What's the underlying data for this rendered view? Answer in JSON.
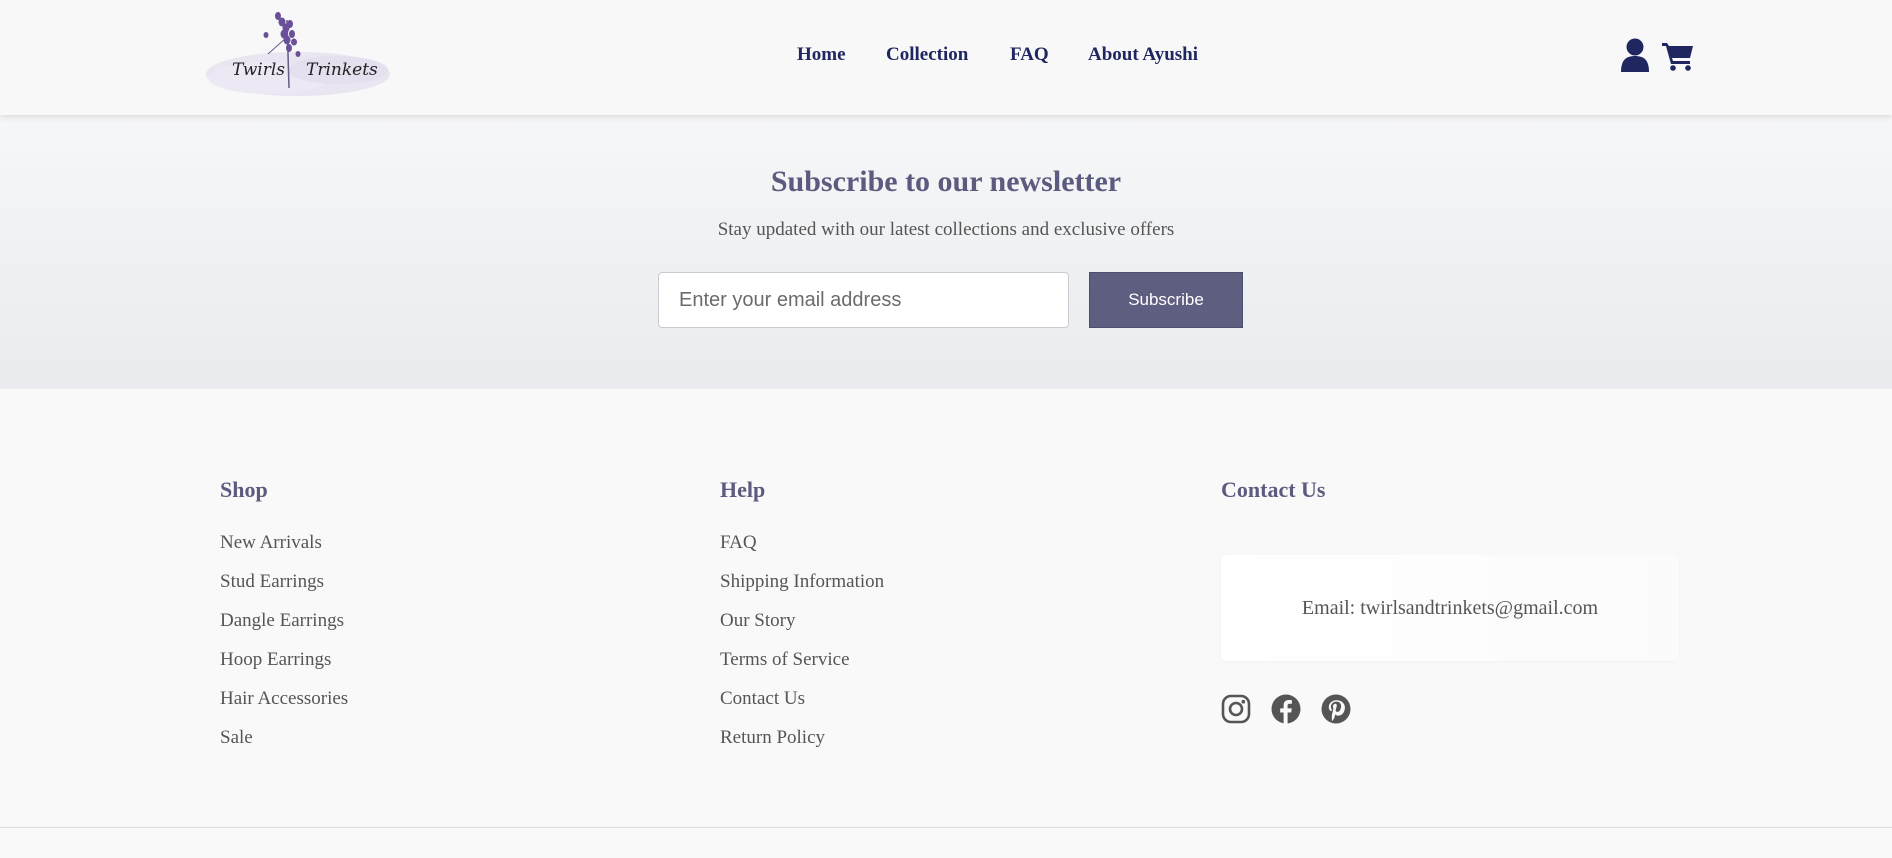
{
  "brand": {
    "logo_word_1": "Twirls",
    "logo_word_2": "Trinkets"
  },
  "nav": {
    "items": [
      {
        "label": "Home"
      },
      {
        "label": "Collection"
      },
      {
        "label": "FAQ"
      },
      {
        "label": "About Ayushi"
      }
    ]
  },
  "header_icons": [
    "user-icon",
    "cart-icon"
  ],
  "newsletter": {
    "title": "Subscribe to our newsletter",
    "subtitle": "Stay updated with our latest collections and exclusive offers",
    "email_placeholder": "Enter your email address",
    "email_value": "",
    "button_label": "Subscribe"
  },
  "footer": {
    "shop": {
      "heading": "Shop",
      "links": [
        "New Arrivals",
        "Stud Earrings",
        "Dangle Earrings",
        "Hoop Earrings",
        "Hair Accessories",
        "Sale"
      ]
    },
    "help": {
      "heading": "Help",
      "links": [
        "FAQ",
        "Shipping Information",
        "Our Story",
        "Terms of Service",
        "Contact Us",
        "Return Policy"
      ]
    },
    "contact": {
      "heading": "Contact Us",
      "email_text": "Email: twirlsandtrinkets@gmail.com"
    },
    "social_icons": [
      "instagram-icon",
      "facebook-icon",
      "pinterest-icon"
    ]
  },
  "colors": {
    "nav_text": "#1f2660",
    "heading": "#5b5b7f",
    "button": "#5e5e80",
    "body_text": "#555555",
    "icon": "#555555"
  }
}
